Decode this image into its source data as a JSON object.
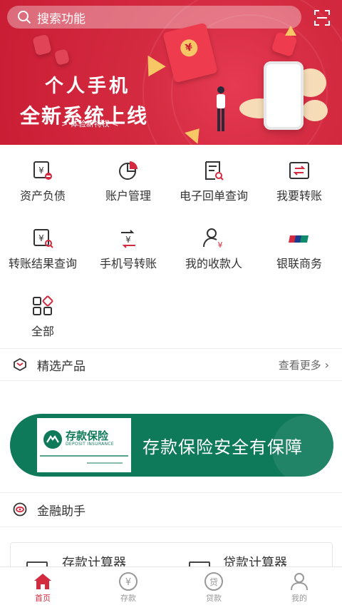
{
  "search": {
    "placeholder": "搜索功能"
  },
  "banner": {
    "title_line1": "个人手机",
    "title_line2": "全新系统上线",
    "subtitle": "> 体验新特权 <",
    "coin_symbol": "¥"
  },
  "grid": [
    {
      "label": "资产负债",
      "icon": "asset-liability-icon"
    },
    {
      "label": "账户管理",
      "icon": "pie-chart-icon"
    },
    {
      "label": "电子回单查询",
      "icon": "receipt-search-icon"
    },
    {
      "label": "我要转账",
      "icon": "transfer-icon"
    },
    {
      "label": "转账结果查询",
      "icon": "transfer-result-icon"
    },
    {
      "label": "手机号转账",
      "icon": "phone-transfer-icon"
    },
    {
      "label": "我的收款人",
      "icon": "payee-icon"
    },
    {
      "label": "银联商务",
      "icon": "unionpay-icon"
    },
    {
      "label": "全部",
      "icon": "all-apps-icon"
    }
  ],
  "products": {
    "title": "精选产品",
    "more": "查看更多"
  },
  "insurance": {
    "brand_cn": "存款保险",
    "brand_en": "DEPOSIT INSURANCE",
    "slogan": "存款保险安全有保障"
  },
  "assistant": {
    "title": "金融助手"
  },
  "calculators": [
    {
      "label": "存款计算器"
    },
    {
      "label": "贷款计算器"
    }
  ],
  "tabbar": [
    {
      "label": "首页",
      "active": true
    },
    {
      "label": "存款",
      "active": false
    },
    {
      "label": "贷款",
      "active": false
    },
    {
      "label": "我的",
      "active": false
    }
  ],
  "colors": {
    "brand": "#d42a40",
    "insurance": "#0f7a5a"
  }
}
